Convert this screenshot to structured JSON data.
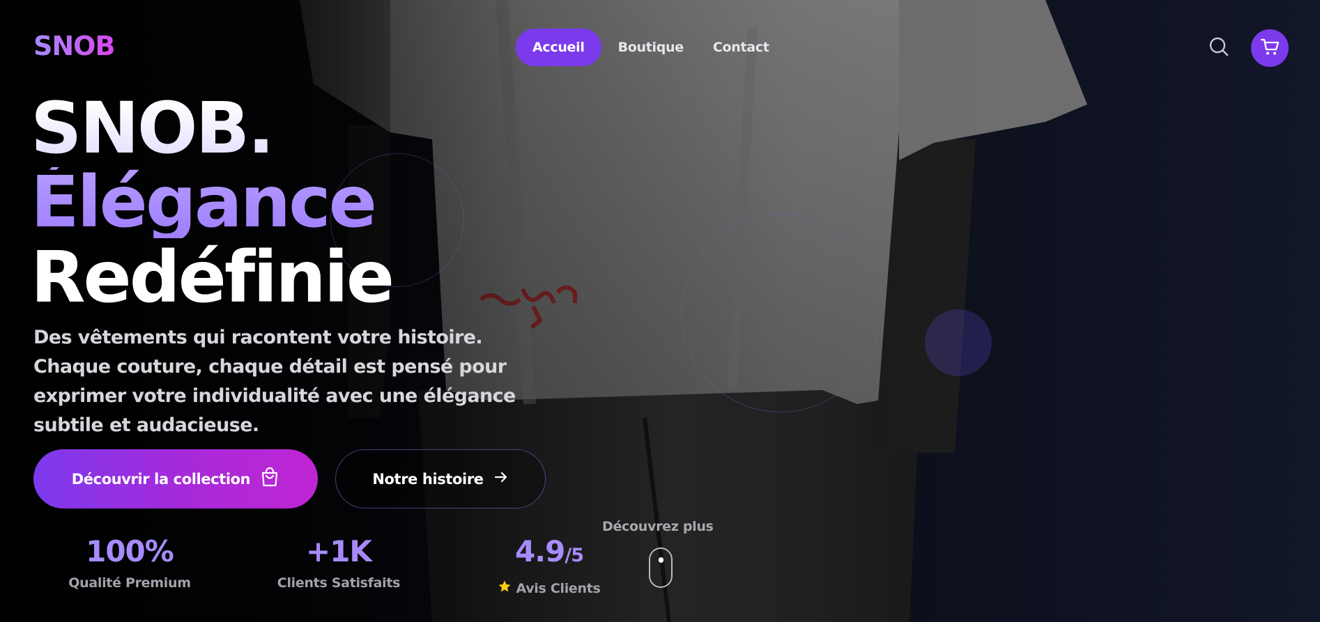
{
  "brand": {
    "logo": "SNOB"
  },
  "nav": {
    "items": [
      {
        "label": "Accueil",
        "active": true
      },
      {
        "label": "Boutique",
        "active": false
      },
      {
        "label": "Contact",
        "active": false
      }
    ],
    "search_icon": "search-icon",
    "cart_icon": "cart-icon"
  },
  "hero": {
    "line1": "SNOB.",
    "line2": "Élégance",
    "line3": "Redéfinie",
    "description": "Des vêtements qui racontent votre histoire. Chaque couture, chaque détail est pensé pour exprimer votre individualité avec une élégance subtile et audacieuse.",
    "primary_button": "Découvrir la collection",
    "primary_icon": "shopping-bag-icon",
    "secondary_button": "Notre histoire",
    "secondary_icon": "arrow-right-icon"
  },
  "stats": [
    {
      "value": "100%",
      "suffix": "",
      "label": "Qualité Premium"
    },
    {
      "value": "+1K",
      "suffix": "",
      "label": "Clients Satisfaits"
    },
    {
      "value": "4.9",
      "suffix": "/5",
      "label": "Avis Clients",
      "icon": "star-icon"
    }
  ],
  "scroll_hint": {
    "label": "Découvrez plus",
    "icon": "mouse-scroll-icon"
  },
  "colors": {
    "accent": "#7c3aed",
    "accent_light": "#a78bfa",
    "gradient_end": "#c026d3",
    "star": "#facc15",
    "background": "#07080d"
  }
}
